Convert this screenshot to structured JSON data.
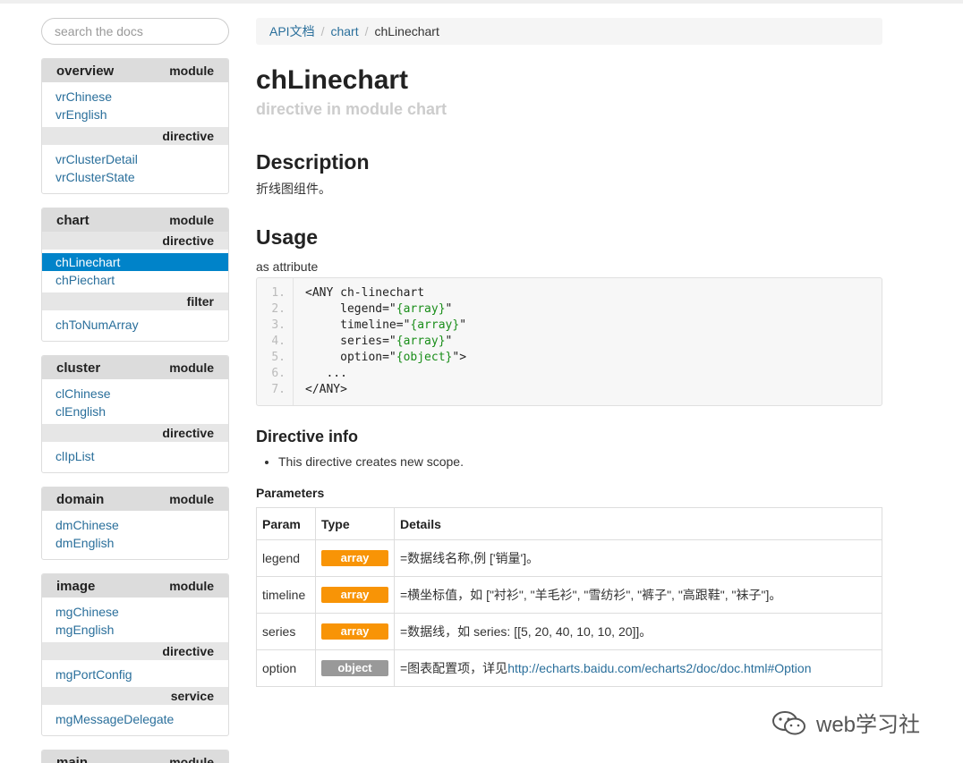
{
  "search": {
    "placeholder": "search the docs"
  },
  "sidebar": {
    "overview": {
      "title": "overview",
      "kind": "module",
      "modules": [
        "vrChinese",
        "vrEnglish"
      ],
      "directive_label": "directive",
      "directives": [
        "vrClusterDetail",
        "vrClusterState"
      ]
    },
    "chart": {
      "title": "chart",
      "kind": "module",
      "directive_label": "directive",
      "directives": [
        "chLinechart",
        "chPiechart"
      ],
      "filter_label": "filter",
      "filters": [
        "chToNumArray"
      ]
    },
    "cluster": {
      "title": "cluster",
      "kind": "module",
      "modules": [
        "clChinese",
        "clEnglish"
      ],
      "directive_label": "directive",
      "directives": [
        "clIpList"
      ]
    },
    "domain": {
      "title": "domain",
      "kind": "module",
      "modules": [
        "dmChinese",
        "dmEnglish"
      ]
    },
    "image": {
      "title": "image",
      "kind": "module",
      "modules": [
        "mgChinese",
        "mgEnglish"
      ],
      "directive_label": "directive",
      "directives": [
        "mgPortConfig"
      ],
      "service_label": "service",
      "services": [
        "mgMessageDelegate"
      ]
    },
    "main": {
      "title": "main",
      "kind": "module"
    }
  },
  "breadcrumb": {
    "root": "API文档",
    "parent": "chart",
    "current": "chLinechart"
  },
  "page": {
    "title": "chLinechart",
    "subtitle": "directive in module chart",
    "description_heading": "Description",
    "description": "折线图组件。",
    "usage_heading": "Usage",
    "usage_sub": "as attribute",
    "code": {
      "numbers": [
        "1.",
        "2.",
        "3.",
        "4.",
        "5.",
        "6.",
        "7."
      ],
      "l1": "<ANY ch-linechart",
      "l2_attr": "     legend=\"",
      "l2_val": "{array}",
      "l2_end": "\"",
      "l3_attr": "     timeline=\"",
      "l3_val": "{array}",
      "l3_end": "\"",
      "l4_attr": "     series=\"",
      "l4_val": "{array}",
      "l4_end": "\"",
      "l5_attr": "     option=\"",
      "l5_val": "{object}",
      "l5_end": "\">",
      "l6": "   ...",
      "l7": "</ANY>"
    },
    "directive_info_heading": "Directive info",
    "directive_info_item": "This directive creates new scope.",
    "parameters_heading": "Parameters",
    "table": {
      "headers": [
        "Param",
        "Type",
        "Details"
      ],
      "rows": [
        {
          "param": "legend",
          "type": "array",
          "details": "=数据线名称,例 ['销量']。"
        },
        {
          "param": "timeline",
          "type": "array",
          "details": "=横坐标值，如 [\"衬衫\", \"羊毛衫\", \"雪纺衫\", \"裤子\", \"高跟鞋\", \"袜子\"]。"
        },
        {
          "param": "series",
          "type": "array",
          "details": "=数据线，如 series: [[5, 20, 40, 10, 10, 20]]。"
        },
        {
          "param": "option",
          "type": "object",
          "details_prefix": "=图表配置项，详见",
          "details_link": "http://echarts.baidu.com/echarts2/doc/doc.html#Option"
        }
      ]
    }
  },
  "watermark": "web学习社",
  "colors": {
    "link": "#2a6f9b",
    "active": "#0083c9",
    "badge_array": "#f89406",
    "badge_object": "#999999"
  }
}
